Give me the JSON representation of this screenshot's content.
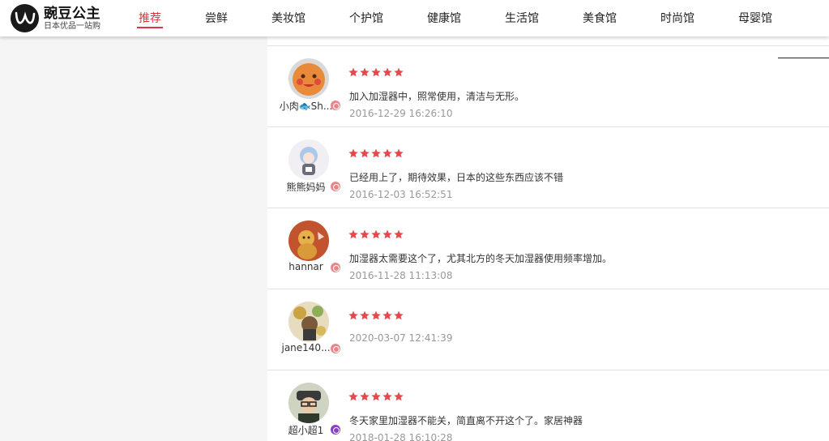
{
  "brand": {
    "name": "豌豆公主",
    "slogan": "日本优品一站购"
  },
  "nav": [
    {
      "label": "推荐",
      "active": true
    },
    {
      "label": "尝鲜"
    },
    {
      "label": "美妆馆"
    },
    {
      "label": "个护馆"
    },
    {
      "label": "健康馆"
    },
    {
      "label": "生活馆"
    },
    {
      "label": "美食馆"
    },
    {
      "label": "时尚馆"
    },
    {
      "label": "母婴馆"
    }
  ],
  "colors": {
    "accent": "#d9363e",
    "star": "#e5484d",
    "badge_pink": "#e8868a",
    "badge_purple": "#8a3fc4"
  },
  "reviews": [
    {
      "user": "小肉🐟Sh...",
      "rating": 5,
      "comment": "加入加湿器中，照常使用，清洁与无形。",
      "date": "2016-12-29 16:26:10",
      "badge": "pink"
    },
    {
      "user": "熊熊妈妈",
      "rating": 5,
      "comment": "已经用上了，期待效果，日本的这些东西应该不错",
      "date": "2016-12-03 16:52:51",
      "badge": "pink"
    },
    {
      "user": "hannar",
      "rating": 5,
      "comment": "加湿器太需要这个了，尤其北方的冬天加湿器使用频率增加。",
      "date": "2016-11-28 11:13:08",
      "badge": "pink"
    },
    {
      "user": "jane140...",
      "rating": 5,
      "comment": "",
      "date": "2020-03-07 12:41:39",
      "badge": "pink"
    },
    {
      "user": "超小超1",
      "rating": 5,
      "comment": "冬天家里加湿器不能关，简直离不开这个了。家居神器",
      "date": "2018-01-28 16:10:28",
      "badge": "purple"
    }
  ]
}
